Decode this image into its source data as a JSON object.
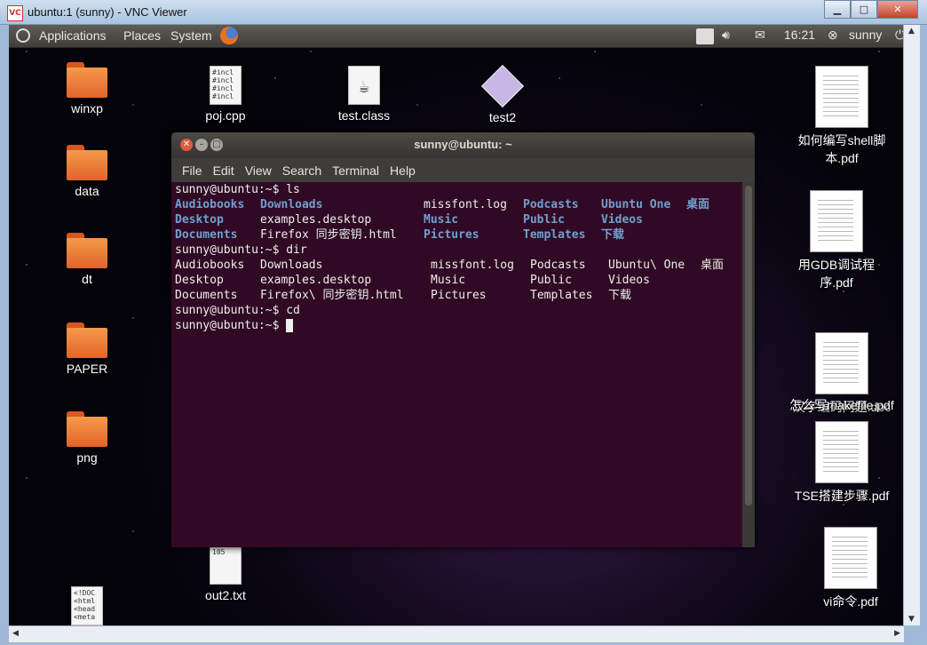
{
  "vnc": {
    "title": "ubuntu:1 (sunny) - VNC Viewer",
    "logo": "VC",
    "min": "▁",
    "max": "□",
    "close": "✕"
  },
  "panel": {
    "applications": "Applications",
    "places": "Places",
    "system": "System",
    "time": "16:21",
    "user": "sunny"
  },
  "icons_left": [
    {
      "label": "winxp"
    },
    {
      "label": "data"
    },
    {
      "label": "dt"
    },
    {
      "label": "PAPER"
    },
    {
      "label": "png"
    }
  ],
  "icons_top": [
    {
      "label": "poj.cpp",
      "thumb": "#incl\n#incl\n#incl\n#incl"
    },
    {
      "label": "test.class"
    },
    {
      "label": "test2"
    }
  ],
  "icons_bottom": [
    {
      "label": "out2.txt",
      "thumb": "105"
    },
    {
      "thumb": "<!DOC\n<html\n<head\n<meta"
    }
  ],
  "icons_right": [
    {
      "label": "如何编写shell脚本.pdf"
    },
    {
      "label": "用GDB调试程序.pdf"
    },
    {
      "label": "汉字编码问题.doc"
    },
    {
      "label": "怎么写makefile.pdf"
    },
    {
      "label": "TSE搭建步骤.pdf"
    },
    {
      "label": "vi命令.pdf"
    }
  ],
  "terminal": {
    "title": "sunny@ubuntu: ~",
    "menu": [
      "File",
      "Edit",
      "View",
      "Search",
      "Terminal",
      "Help"
    ],
    "prompt": "sunny@ubuntu:~$ ",
    "cmd_ls": "ls",
    "ls": [
      [
        "Audiobooks",
        "Downloads",
        "",
        "missfont.log",
        "Podcasts",
        "Ubuntu One",
        "桌面"
      ],
      [
        "Desktop",
        "",
        "examples.desktop",
        "",
        "Music",
        "Public",
        "Videos"
      ],
      [
        "Documents",
        "",
        "Firefox 同步密钥.html",
        "",
        "Pictures",
        "Templates",
        "下载"
      ]
    ],
    "cmd_dir": "dir",
    "dir": [
      [
        "Audiobooks",
        "Downloads",
        "missfont.log",
        "Podcasts",
        "Ubuntu\\ One",
        "桌面"
      ],
      [
        "Desktop",
        "examples.desktop",
        "Music",
        "Public",
        "Videos",
        ""
      ],
      [
        "Documents",
        "Firefox\\ 同步密钥.html",
        "Pictures",
        "Templates",
        "下载",
        ""
      ]
    ],
    "cmd_cd": "cd"
  }
}
